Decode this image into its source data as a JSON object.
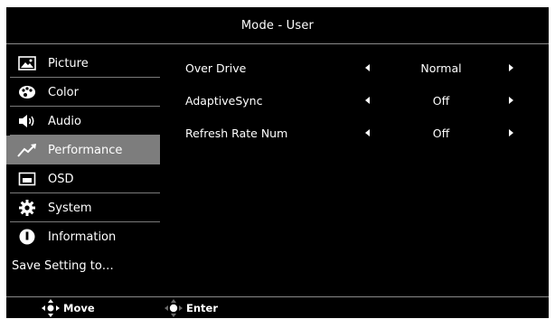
{
  "title": "Mode - User",
  "sidebar": {
    "items": [
      {
        "label": "Picture",
        "icon": "picture-icon"
      },
      {
        "label": "Color",
        "icon": "color-palette-icon"
      },
      {
        "label": "Audio",
        "icon": "speaker-icon"
      },
      {
        "label": "Performance",
        "icon": "performance-chart-icon",
        "active": true
      },
      {
        "label": "OSD",
        "icon": "osd-screen-icon"
      },
      {
        "label": "System",
        "icon": "gear-icon"
      },
      {
        "label": "Information",
        "icon": "info-icon"
      },
      {
        "label": "Save Setting to…"
      }
    ]
  },
  "settings": [
    {
      "label": "Over Drive",
      "value": "Normal"
    },
    {
      "label": "AdaptiveSync",
      "value": "Off"
    },
    {
      "label": "Refresh Rate Num",
      "value": "Off"
    }
  ],
  "footer": {
    "move_label": "Move",
    "enter_label": "Enter"
  },
  "colors": {
    "background": "#000000",
    "active_item": "#7d7d7d",
    "separator": "#7a7a7a",
    "text": "#ffffff"
  }
}
